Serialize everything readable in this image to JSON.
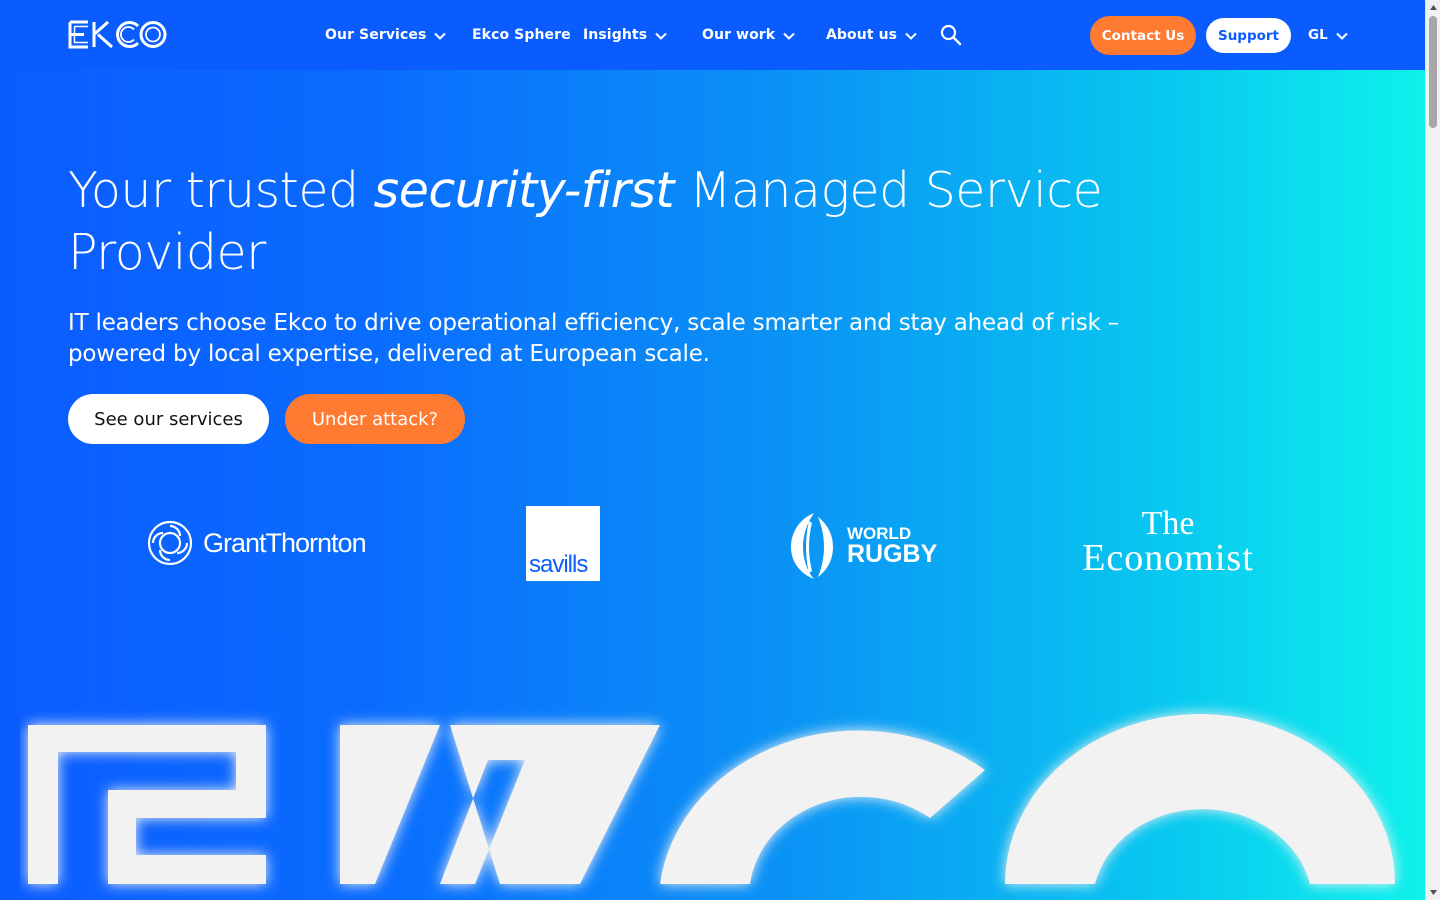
{
  "brand": {
    "logo_text": "EKCO"
  },
  "nav": {
    "items": [
      {
        "label": "Our Services",
        "has_dropdown": true
      },
      {
        "label": "Ekco Sphere",
        "has_dropdown": false
      },
      {
        "label": "Insights",
        "has_dropdown": true
      },
      {
        "label": "Our work",
        "has_dropdown": true
      },
      {
        "label": "About us",
        "has_dropdown": true
      }
    ],
    "search_icon": "search-icon",
    "contact_label": "Contact Us",
    "support_label": "Support",
    "language": "GL"
  },
  "hero": {
    "title_pre": "Your trusted ",
    "title_em": "security-first",
    "title_post": " Managed Service Provider",
    "subtitle": "IT leaders choose Ekco to drive operational efficiency, scale smarter and stay ahead of risk – powered by local expertise, delivered at European scale.",
    "primary_button": "See our services",
    "secondary_button": "Under attack?"
  },
  "clients": {
    "grant_thornton": "GrantThornton",
    "savills": "savills",
    "world_rugby_line1": "WORLD",
    "world_rugby_line2": "RUGBY",
    "economist_line1": "The",
    "economist_line2": "Economist"
  },
  "colors": {
    "header_bg": "#0b5cff",
    "accent_orange": "#ff7b32",
    "gradient_start": "#0b5cff",
    "gradient_end": "#0ef4ec"
  }
}
